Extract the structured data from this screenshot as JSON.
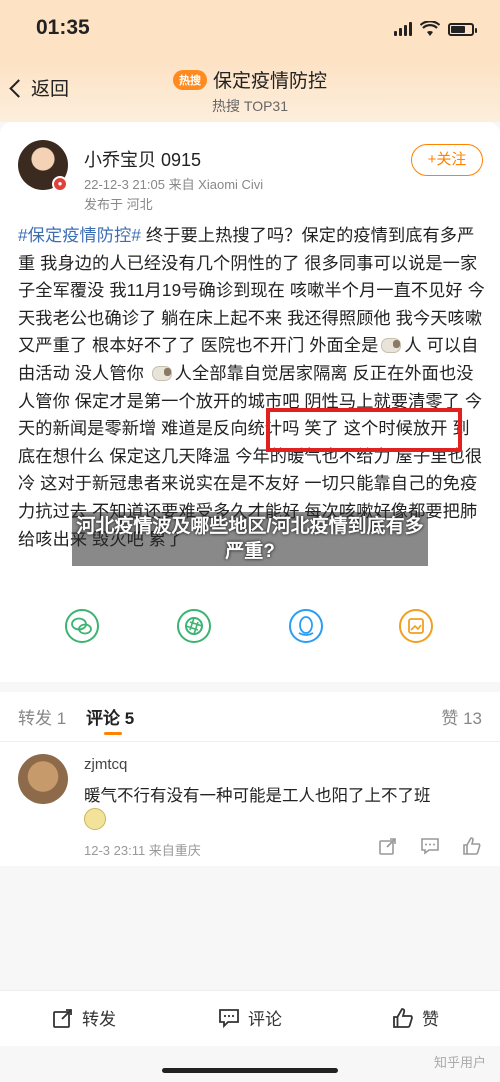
{
  "status_bar": {
    "time": "01:35"
  },
  "header": {
    "back_label": "返回",
    "hot_badge": "热搜",
    "topic": "保定疫情防控",
    "rank": "热搜 TOP31"
  },
  "post": {
    "username": "小乔宝贝 0915",
    "meta": "22-12-3 21:05  来自 Xiaomi Civi",
    "location": "发布于 河北",
    "follow_label": "+关注",
    "hashtag": "#保定疫情防控#",
    "body_1": " 终于要上热搜了吗？保定的疫情到底有多严重 我身边的人已经没有几个阴性的了 很多同事可以说是一家子全军覆没 我11月19号确诊到现在 咳嗽半个月一直不见好 今天我老公也确诊了 躺在床上起不来 我还得照顾他 我今天咳嗽又严重了 根本好不了了 医院也不开门 外面全是",
    "body_2": "人 可以自由活动 没人管你 ",
    "body_3": "人全部靠自觉居家隔离 反正在外面也没人管你 保定才是第一个放开的城市吧 阴性马上就要清零了 今天的新闻是零新增 难道是反向统计吗 笑了 这个时候放开 到底在想什么 保定这几天降温 今年的暖气也不给力 屋子里也很冷 这对于新冠患者来说实在是不友好 一切只能靠自己的免疫力抗过去 不知道还要难受多久才能好 每次咳嗽好像都要把肺给咳出来 毁灭吧 累了"
  },
  "overlay_caption": "河北疫情波及哪些地区/河北疫情到底有多严重?",
  "tabs": {
    "repost": "转发 1",
    "comment": "评论 5",
    "like": "赞 13"
  },
  "comment": {
    "username": "zjmtcq",
    "text": "暖气不行有没有一种可能是工人也阳了上不了班",
    "meta": "12-3 23:11  来自重庆"
  },
  "bottom_bar": {
    "repost": "转发",
    "comment": "评论",
    "like": "赞"
  },
  "watermark": "知乎用户",
  "colors": {
    "accent": "#ff8200",
    "link": "#3c6eb4",
    "highlight": "#e22020"
  }
}
